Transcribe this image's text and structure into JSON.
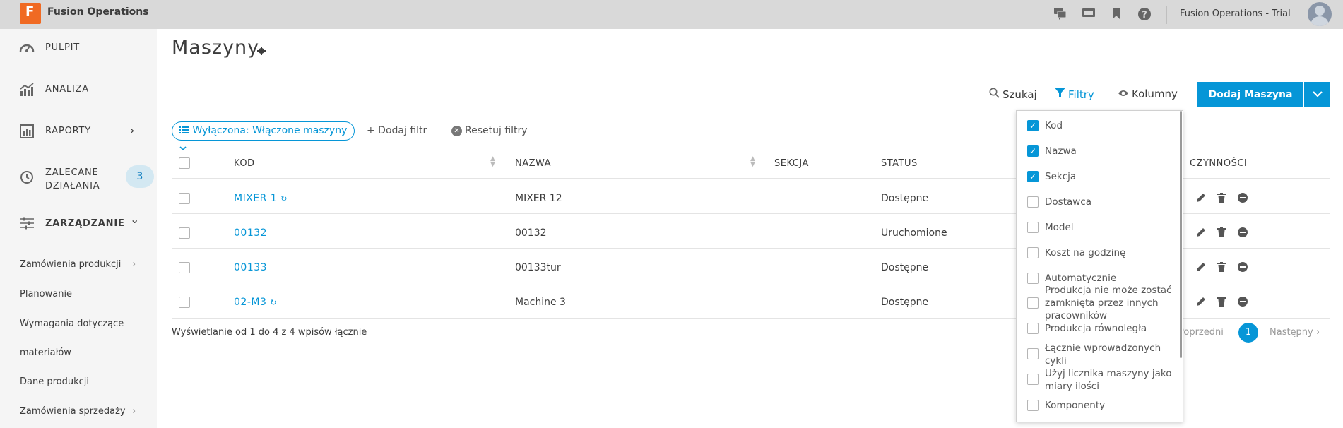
{
  "app": {
    "logo_letter": "F",
    "title": "Fusion Operations",
    "trial_label": "Fusion Operations - Trial"
  },
  "topbar_icons": [
    "chat-icon",
    "screen-icon",
    "bookmark-icon",
    "help-icon"
  ],
  "sidebar": {
    "items": [
      {
        "label": "PULPIT",
        "icon": "dashboard-icon"
      },
      {
        "label": "ANALIZA",
        "icon": "analytics-icon"
      },
      {
        "label": "RAPORTY",
        "icon": "reports-icon",
        "chevron": "›"
      },
      {
        "label": "ZALECANE DZIAŁANIA",
        "label_line1": "ZALECANE",
        "label_line2": "DZIAŁANIA",
        "icon": "history-icon",
        "badge": "3"
      },
      {
        "label": "ZARZĄDZANIE",
        "icon": "settings-sliders-icon",
        "chevron": "⌄"
      }
    ],
    "sub_items": [
      {
        "label": "Zamówienia produkcji",
        "chevron": "›"
      },
      {
        "label": "Planowanie"
      },
      {
        "label": "Wymagania dotyczące"
      },
      {
        "label": "materiałów"
      },
      {
        "label": "Dane produkcji"
      },
      {
        "label": "Zamówienia sprzedaży",
        "chevron": "›"
      }
    ]
  },
  "page": {
    "title": "Maszyny"
  },
  "toolbar": {
    "search": "Szukaj",
    "filters": "Filtry",
    "columns": "Kolumny",
    "add_button": "Dodaj Maszyna"
  },
  "filters": {
    "active_chip": "Wyłączona: Włączone maszyny",
    "add_filter": "+ Dodaj filtr",
    "reset": "Resetuj filtry"
  },
  "table": {
    "headers": {
      "kod": "KOD",
      "nazwa": "NAZWA",
      "sekcja": "SEKCJA",
      "status": "STATUS",
      "actions": "CZYNNOŚCI"
    },
    "rows": [
      {
        "kod": "MIXER 1",
        "nazwa": "MIXER 12",
        "sekcja": "",
        "status": "Dostępne",
        "synced": true
      },
      {
        "kod": "00132",
        "nazwa": "00132",
        "sekcja": "",
        "status": "Uruchomione",
        "synced": false
      },
      {
        "kod": "00133",
        "nazwa": "00133tur",
        "sekcja": "",
        "status": "Dostępne",
        "synced": false
      },
      {
        "kod": "02-M3",
        "nazwa": "Machine 3",
        "sekcja": "",
        "status": "Dostępne",
        "synced": true
      }
    ],
    "footer": "Wyświetlanie od 1 do 4 z 4 wpisów łącznie"
  },
  "pagination": {
    "prev": "Poprzedni",
    "current": "1",
    "next": "Następny ›"
  },
  "columns_menu": [
    {
      "label": "Kod",
      "checked": true
    },
    {
      "label": "Nazwa",
      "checked": true
    },
    {
      "label": "Sekcja",
      "checked": true
    },
    {
      "label": "Dostawca",
      "checked": false
    },
    {
      "label": "Model",
      "checked": false
    },
    {
      "label": "Koszt na godzinę",
      "checked": false
    },
    {
      "label": "Automatycznie",
      "checked": false
    },
    {
      "label": "Produkcja nie może zostać zamknięta przez innych pracowników",
      "checked": false
    },
    {
      "label": "Produkcja równoległa",
      "checked": false
    },
    {
      "label": "Łącznie wprowadzonych cykli",
      "checked": false
    },
    {
      "label": "Użyj licznika maszyny jako miary ilości",
      "checked": false
    },
    {
      "label": "Komponenty",
      "checked": false
    }
  ],
  "colors": {
    "accent": "#0696d7",
    "logo": "#f06a23",
    "topbar": "#d9d9d9",
    "sidebar": "#f5f5f5",
    "badge_bg": "#d3e8f2"
  }
}
